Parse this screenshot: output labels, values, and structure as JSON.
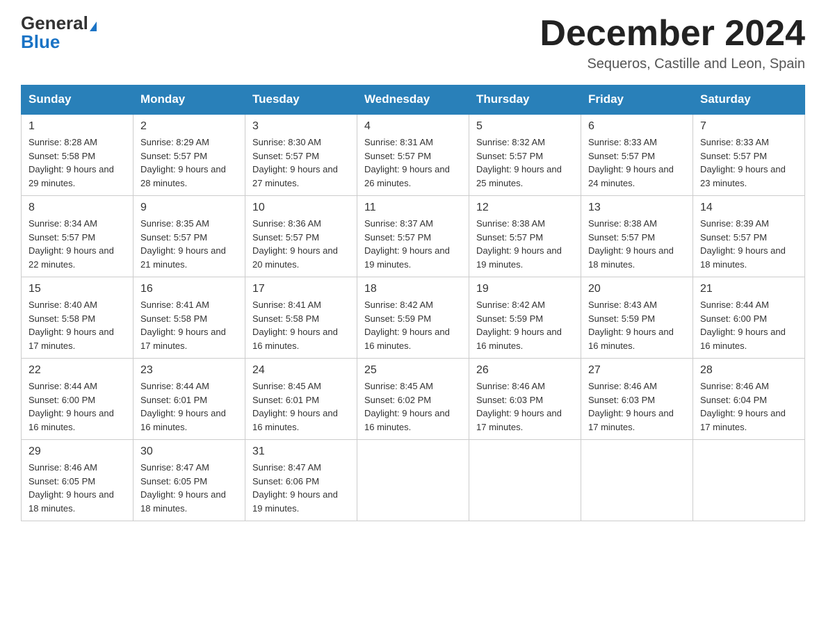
{
  "header": {
    "logo_general": "General",
    "logo_blue": "Blue",
    "month_title": "December 2024",
    "location": "Sequeros, Castille and Leon, Spain"
  },
  "days_of_week": [
    "Sunday",
    "Monday",
    "Tuesday",
    "Wednesday",
    "Thursday",
    "Friday",
    "Saturday"
  ],
  "weeks": [
    [
      {
        "day": "1",
        "sunrise": "Sunrise: 8:28 AM",
        "sunset": "Sunset: 5:58 PM",
        "daylight": "Daylight: 9 hours and 29 minutes."
      },
      {
        "day": "2",
        "sunrise": "Sunrise: 8:29 AM",
        "sunset": "Sunset: 5:57 PM",
        "daylight": "Daylight: 9 hours and 28 minutes."
      },
      {
        "day": "3",
        "sunrise": "Sunrise: 8:30 AM",
        "sunset": "Sunset: 5:57 PM",
        "daylight": "Daylight: 9 hours and 27 minutes."
      },
      {
        "day": "4",
        "sunrise": "Sunrise: 8:31 AM",
        "sunset": "Sunset: 5:57 PM",
        "daylight": "Daylight: 9 hours and 26 minutes."
      },
      {
        "day": "5",
        "sunrise": "Sunrise: 8:32 AM",
        "sunset": "Sunset: 5:57 PM",
        "daylight": "Daylight: 9 hours and 25 minutes."
      },
      {
        "day": "6",
        "sunrise": "Sunrise: 8:33 AM",
        "sunset": "Sunset: 5:57 PM",
        "daylight": "Daylight: 9 hours and 24 minutes."
      },
      {
        "day": "7",
        "sunrise": "Sunrise: 8:33 AM",
        "sunset": "Sunset: 5:57 PM",
        "daylight": "Daylight: 9 hours and 23 minutes."
      }
    ],
    [
      {
        "day": "8",
        "sunrise": "Sunrise: 8:34 AM",
        "sunset": "Sunset: 5:57 PM",
        "daylight": "Daylight: 9 hours and 22 minutes."
      },
      {
        "day": "9",
        "sunrise": "Sunrise: 8:35 AM",
        "sunset": "Sunset: 5:57 PM",
        "daylight": "Daylight: 9 hours and 21 minutes."
      },
      {
        "day": "10",
        "sunrise": "Sunrise: 8:36 AM",
        "sunset": "Sunset: 5:57 PM",
        "daylight": "Daylight: 9 hours and 20 minutes."
      },
      {
        "day": "11",
        "sunrise": "Sunrise: 8:37 AM",
        "sunset": "Sunset: 5:57 PM",
        "daylight": "Daylight: 9 hours and 19 minutes."
      },
      {
        "day": "12",
        "sunrise": "Sunrise: 8:38 AM",
        "sunset": "Sunset: 5:57 PM",
        "daylight": "Daylight: 9 hours and 19 minutes."
      },
      {
        "day": "13",
        "sunrise": "Sunrise: 8:38 AM",
        "sunset": "Sunset: 5:57 PM",
        "daylight": "Daylight: 9 hours and 18 minutes."
      },
      {
        "day": "14",
        "sunrise": "Sunrise: 8:39 AM",
        "sunset": "Sunset: 5:57 PM",
        "daylight": "Daylight: 9 hours and 18 minutes."
      }
    ],
    [
      {
        "day": "15",
        "sunrise": "Sunrise: 8:40 AM",
        "sunset": "Sunset: 5:58 PM",
        "daylight": "Daylight: 9 hours and 17 minutes."
      },
      {
        "day": "16",
        "sunrise": "Sunrise: 8:41 AM",
        "sunset": "Sunset: 5:58 PM",
        "daylight": "Daylight: 9 hours and 17 minutes."
      },
      {
        "day": "17",
        "sunrise": "Sunrise: 8:41 AM",
        "sunset": "Sunset: 5:58 PM",
        "daylight": "Daylight: 9 hours and 16 minutes."
      },
      {
        "day": "18",
        "sunrise": "Sunrise: 8:42 AM",
        "sunset": "Sunset: 5:59 PM",
        "daylight": "Daylight: 9 hours and 16 minutes."
      },
      {
        "day": "19",
        "sunrise": "Sunrise: 8:42 AM",
        "sunset": "Sunset: 5:59 PM",
        "daylight": "Daylight: 9 hours and 16 minutes."
      },
      {
        "day": "20",
        "sunrise": "Sunrise: 8:43 AM",
        "sunset": "Sunset: 5:59 PM",
        "daylight": "Daylight: 9 hours and 16 minutes."
      },
      {
        "day": "21",
        "sunrise": "Sunrise: 8:44 AM",
        "sunset": "Sunset: 6:00 PM",
        "daylight": "Daylight: 9 hours and 16 minutes."
      }
    ],
    [
      {
        "day": "22",
        "sunrise": "Sunrise: 8:44 AM",
        "sunset": "Sunset: 6:00 PM",
        "daylight": "Daylight: 9 hours and 16 minutes."
      },
      {
        "day": "23",
        "sunrise": "Sunrise: 8:44 AM",
        "sunset": "Sunset: 6:01 PM",
        "daylight": "Daylight: 9 hours and 16 minutes."
      },
      {
        "day": "24",
        "sunrise": "Sunrise: 8:45 AM",
        "sunset": "Sunset: 6:01 PM",
        "daylight": "Daylight: 9 hours and 16 minutes."
      },
      {
        "day": "25",
        "sunrise": "Sunrise: 8:45 AM",
        "sunset": "Sunset: 6:02 PM",
        "daylight": "Daylight: 9 hours and 16 minutes."
      },
      {
        "day": "26",
        "sunrise": "Sunrise: 8:46 AM",
        "sunset": "Sunset: 6:03 PM",
        "daylight": "Daylight: 9 hours and 17 minutes."
      },
      {
        "day": "27",
        "sunrise": "Sunrise: 8:46 AM",
        "sunset": "Sunset: 6:03 PM",
        "daylight": "Daylight: 9 hours and 17 minutes."
      },
      {
        "day": "28",
        "sunrise": "Sunrise: 8:46 AM",
        "sunset": "Sunset: 6:04 PM",
        "daylight": "Daylight: 9 hours and 17 minutes."
      }
    ],
    [
      {
        "day": "29",
        "sunrise": "Sunrise: 8:46 AM",
        "sunset": "Sunset: 6:05 PM",
        "daylight": "Daylight: 9 hours and 18 minutes."
      },
      {
        "day": "30",
        "sunrise": "Sunrise: 8:47 AM",
        "sunset": "Sunset: 6:05 PM",
        "daylight": "Daylight: 9 hours and 18 minutes."
      },
      {
        "day": "31",
        "sunrise": "Sunrise: 8:47 AM",
        "sunset": "Sunset: 6:06 PM",
        "daylight": "Daylight: 9 hours and 19 minutes."
      },
      null,
      null,
      null,
      null
    ]
  ]
}
